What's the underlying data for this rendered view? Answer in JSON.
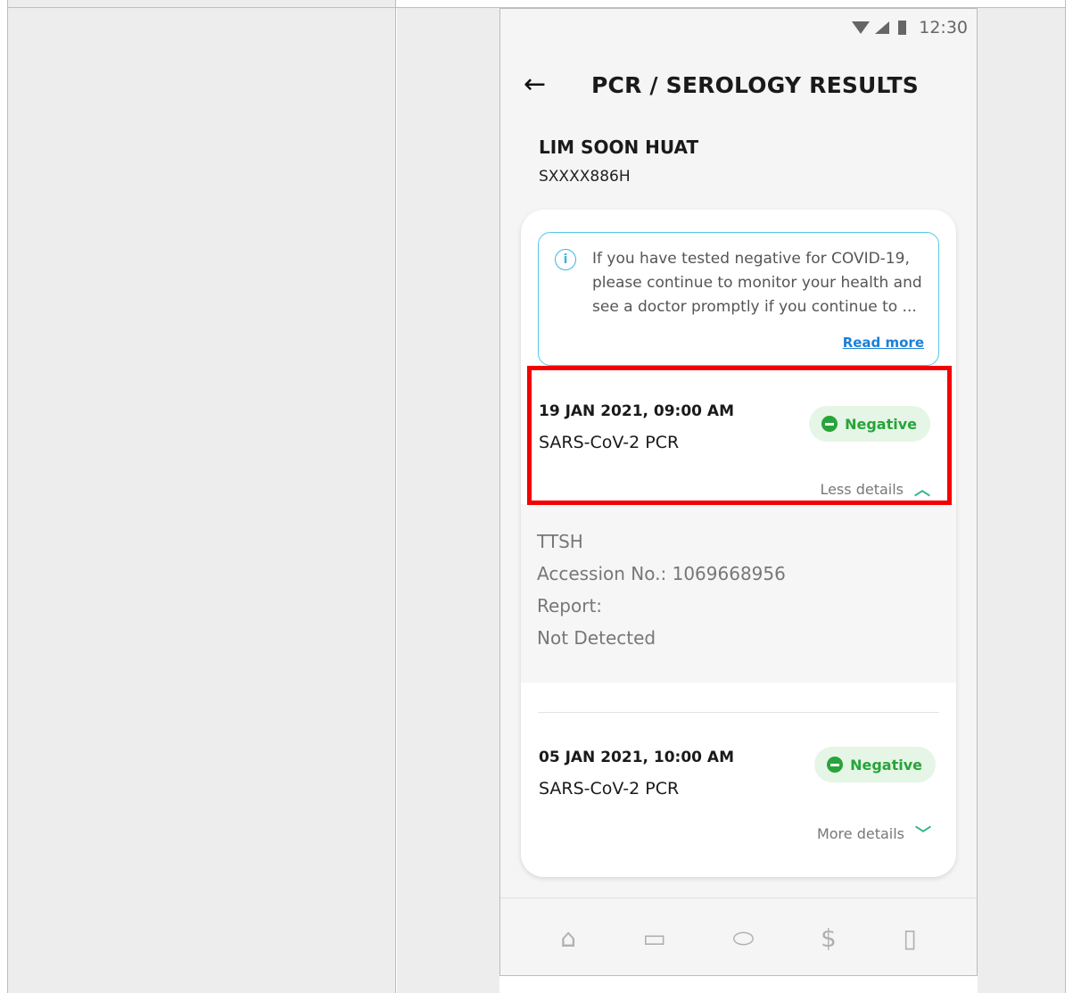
{
  "status_bar": {
    "time": "12:30"
  },
  "header": {
    "back_icon": "arrow-left-icon",
    "title": "PCR / SEROLOGY RESULTS"
  },
  "patient": {
    "name": "LIM SOON HUAT",
    "id": "SXXXX886H"
  },
  "info_box": {
    "icon": "info-icon",
    "text": "If you have tested negative for COVID-19, please continue to monitor your health and see a doctor promptly if you continue to ...",
    "read_more": "Read more"
  },
  "results": [
    {
      "datetime": "19 JAN 2021, 09:00 AM",
      "test": "SARS-CoV-2 PCR",
      "status": "Negative",
      "toggle": "Less details",
      "details": {
        "site": "TTSH",
        "accession": "Accession No.: 1069668956",
        "report_label": "Report:",
        "report_value": "Not Detected"
      }
    },
    {
      "datetime": "05 JAN 2021, 10:00 AM",
      "test": "SARS-CoV-2 PCR",
      "status": "Negative",
      "toggle": "More details"
    }
  ],
  "colors": {
    "negative": "#27a43a",
    "highlight": "#f40000",
    "link": "#1b80d6",
    "info_border": "#55c8e6"
  },
  "bottom_nav": [
    "home-icon",
    "calendar-icon",
    "pill-icon",
    "dollar-icon",
    "report-icon"
  ]
}
